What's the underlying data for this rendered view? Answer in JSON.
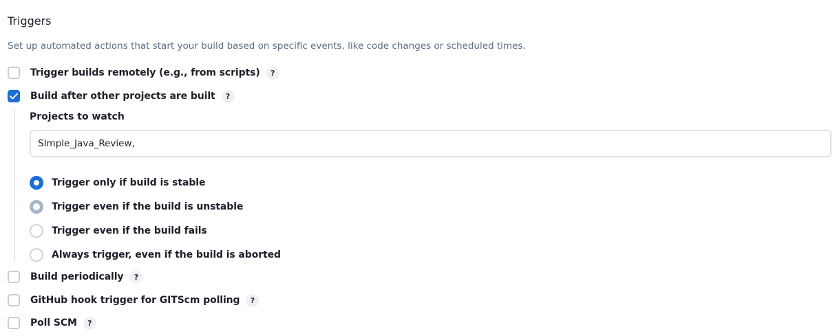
{
  "triggers": {
    "title": "Triggers",
    "description": "Set up automated actions that start your build based on specific events, like code changes or scheduled times.",
    "help_glyph": "?",
    "options": {
      "remote": {
        "label": "Trigger builds remotely (e.g., from scripts)",
        "checked": false
      },
      "after_other": {
        "label": "Build after other projects are built",
        "checked": true
      },
      "periodically": {
        "label": "Build periodically",
        "checked": false
      },
      "github_hook": {
        "label": "GitHub hook trigger for GITScm polling",
        "checked": false
      },
      "poll_scm": {
        "label": "Poll SCM",
        "checked": false
      }
    },
    "projects_to_watch": {
      "label": "Projects to watch",
      "value": "SImple_Java_Review,"
    },
    "radios": {
      "stable": {
        "label": "Trigger only if build is stable",
        "selected": true
      },
      "unstable": {
        "label": "Trigger even if the build is unstable",
        "selected": false
      },
      "fails": {
        "label": "Trigger even if the build fails",
        "selected": false
      },
      "aborted": {
        "label": "Always trigger, even if the build is aborted",
        "selected": false
      }
    }
  },
  "colors": {
    "accent": "#1a6ed8",
    "description": "#5c6f85",
    "border": "#c9ced6"
  },
  "icons": {
    "checkmark": "check-icon",
    "help": "help-icon"
  }
}
